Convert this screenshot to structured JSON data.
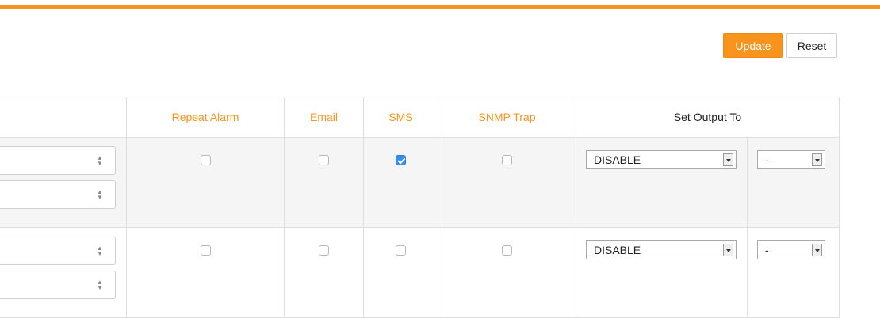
{
  "toolbar": {
    "update_label": "Update",
    "reset_label": "Reset"
  },
  "table": {
    "headers": {
      "repeat_alarm": "Repeat Alarm",
      "email": "Email",
      "sms": "SMS",
      "snmp_trap": "SNMP Trap",
      "set_output_to": "Set Output To"
    },
    "rows": [
      {
        "repeat_alarm": false,
        "email": false,
        "sms": true,
        "snmp_trap": false,
        "output": "DISABLE",
        "output_secondary": "-"
      },
      {
        "repeat_alarm": false,
        "email": false,
        "sms": false,
        "snmp_trap": false,
        "output": "DISABLE",
        "output_secondary": "-"
      }
    ]
  },
  "colors": {
    "accent": "#f7941d",
    "checkbox_checked": "#3b8ee8"
  }
}
